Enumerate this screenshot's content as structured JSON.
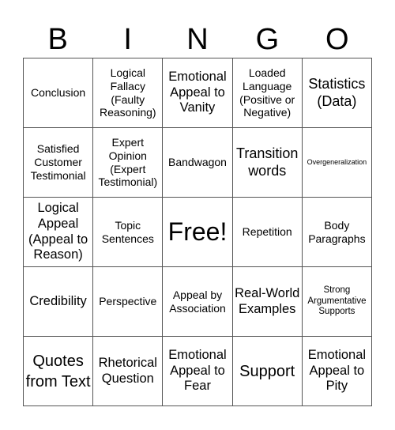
{
  "header": {
    "letters": [
      "B",
      "I",
      "N",
      "G",
      "O"
    ]
  },
  "board": {
    "rows": [
      [
        "Conclusion",
        "Logical Fallacy (Faulty Reasoning)",
        "Emotional Appeal to Vanity",
        "Loaded Language (Positive or Negative)",
        "Statistics (Data)"
      ],
      [
        "Satisfied Customer Testimonial",
        "Expert Opinion (Expert Testimonial)",
        "Bandwagon",
        "Transition words",
        "Overgeneralization"
      ],
      [
        "Logical Appeal (Appeal to Reason)",
        "Topic Sentences",
        "Free!",
        "Repetition",
        "Body Paragraphs"
      ],
      [
        "Credibility",
        "Perspective",
        "Appeal by Association",
        "Real-World Examples",
        "Strong Argumentative Supports"
      ],
      [
        "Quotes from Text",
        "Rhetorical Question",
        "Emotional Appeal to Fear",
        "Support",
        "Emotional Appeal to Pity"
      ]
    ]
  }
}
